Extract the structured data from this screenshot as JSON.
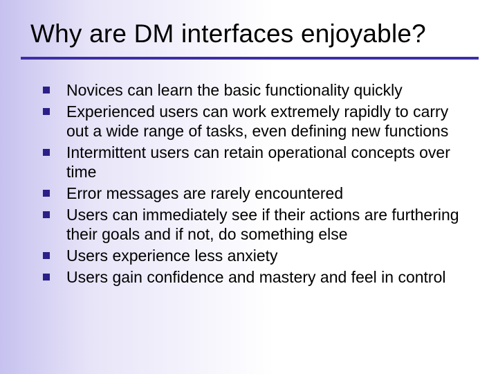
{
  "slide": {
    "title": "Why are DM interfaces enjoyable?",
    "bullets": [
      "Novices can learn the basic functionality quickly",
      "Experienced users can work extremely rapidly to carry out a wide range of tasks, even defining new functions",
      "Intermittent users can retain operational concepts over time",
      "Error messages are rarely encountered",
      "Users can immediately see if their actions are furthering their goals and if not, do something else",
      "Users experience less anxiety",
      "Users gain confidence and mastery and feel in control"
    ]
  }
}
